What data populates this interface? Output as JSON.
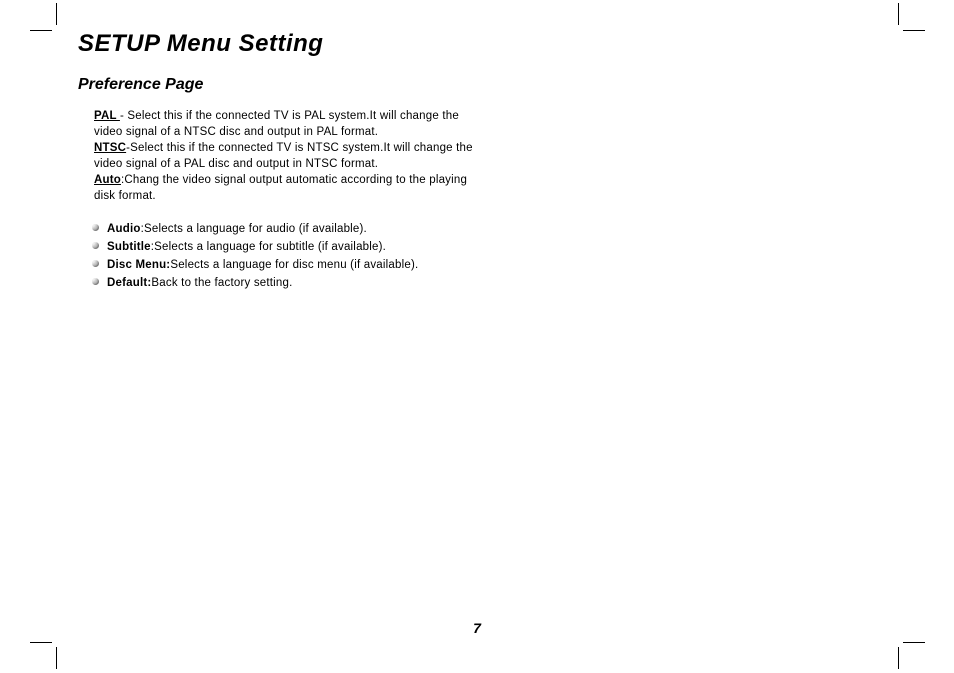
{
  "title": "SETUP Menu Setting",
  "subtitle": "Preference Page",
  "definitions": [
    {
      "term": "PAL ",
      "sep": "- ",
      "desc": "Select this if the connected TV is PAL system.It will change the video signal of a NTSC disc and output in PAL format."
    },
    {
      "term": "NTSC",
      "sep": "-",
      "desc": "Select this if the connected TV is NTSC system.It will change the video signal of a PAL disc and output in NTSC format."
    },
    {
      "term": "Auto",
      "sep": ":",
      "desc": "Chang the video signal output automatic according to the playing disk format."
    }
  ],
  "list": [
    {
      "label": "Audio",
      "sep": ":",
      "desc": "Selects a language for audio (if available)."
    },
    {
      "label": "Subtitle",
      "sep": ":",
      "desc": "Selects a language for subtitle (if available)."
    },
    {
      "label": "Disc Menu:",
      "sep": "",
      "desc": "Selects a language for disc menu (if available)."
    },
    {
      "label": "Default:",
      "sep": "",
      "desc": "Back to the factory setting."
    }
  ],
  "pageNumber": "7"
}
